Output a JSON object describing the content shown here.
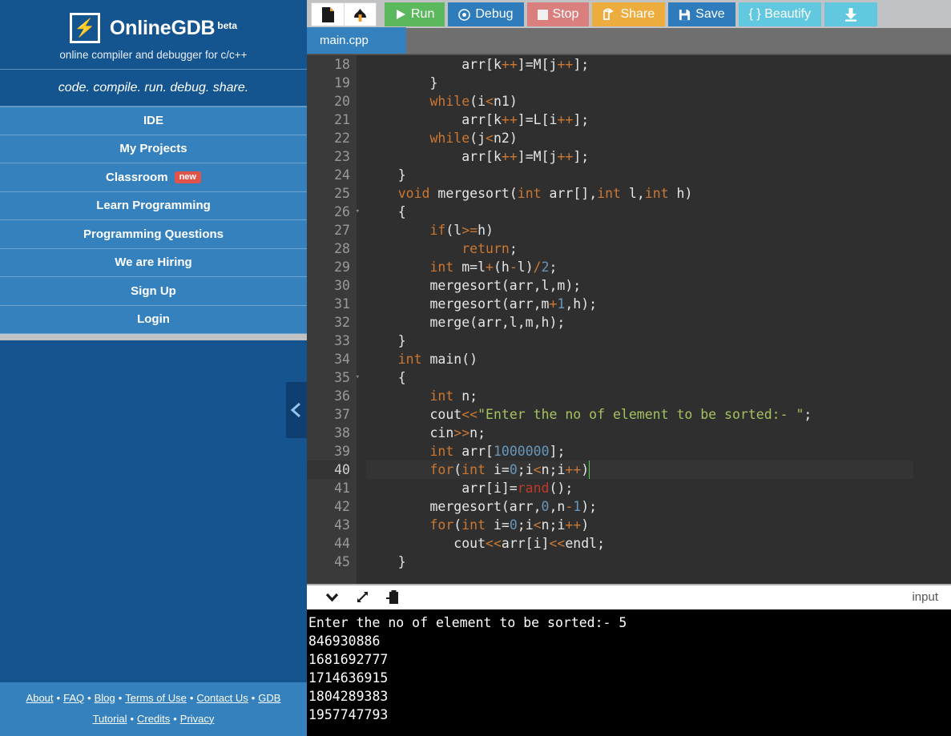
{
  "brand": {
    "logo_icon": "lightning-bolt-icon",
    "name": "OnlineGDB",
    "beta": "beta",
    "tagline": "online compiler and debugger for c/c++",
    "slogan": "code. compile. run. debug. share."
  },
  "sidebar": {
    "items": [
      {
        "label": "IDE",
        "badge": null
      },
      {
        "label": "My Projects",
        "badge": null
      },
      {
        "label": "Classroom",
        "badge": "new"
      },
      {
        "label": "Learn Programming",
        "badge": null
      },
      {
        "label": "Programming Questions",
        "badge": null
      },
      {
        "label": "We are Hiring",
        "badge": null
      },
      {
        "label": "Sign Up",
        "badge": null
      },
      {
        "label": "Login",
        "badge": null
      }
    ],
    "collapse_icon": "chevron-left-icon"
  },
  "footer": {
    "links": [
      "About",
      "FAQ",
      "Blog",
      "Terms of Use",
      "Contact Us",
      "GDB Tutorial",
      "Credits",
      "Privacy"
    ],
    "separator": "•"
  },
  "toolbar": {
    "new_file_icon": "new-file-icon",
    "upload_icon": "upload-icon",
    "run_label": "Run",
    "debug_label": "Debug",
    "stop_label": "Stop",
    "share_label": "Share",
    "save_label": "Save",
    "beautify_label": "{ } Beautify",
    "download_icon": "download-icon",
    "colors": {
      "run": "#5cb85c",
      "debug": "#2e7cbc",
      "stop": "#d9807f",
      "share": "#edad3e",
      "save": "#2e7cbc",
      "beautify": "#62c8e0"
    }
  },
  "tabs": [
    {
      "label": "main.cpp",
      "active": true
    }
  ],
  "editor": {
    "first_line": 18,
    "active_line": 40,
    "lines": [
      {
        "n": 18,
        "tokens": [
          {
            "t": "            arr[k",
            "c": "p"
          },
          {
            "t": "++",
            "c": "k"
          },
          {
            "t": "]=M[j",
            "c": "p"
          },
          {
            "t": "++",
            "c": "k"
          },
          {
            "t": "];",
            "c": "p"
          }
        ]
      },
      {
        "n": 19,
        "tokens": [
          {
            "t": "        }",
            "c": "p"
          }
        ]
      },
      {
        "n": 20,
        "tokens": [
          {
            "t": "        ",
            "c": "p"
          },
          {
            "t": "while",
            "c": "k"
          },
          {
            "t": "(i",
            "c": "p"
          },
          {
            "t": "<",
            "c": "k"
          },
          {
            "t": "n1)",
            "c": "p"
          }
        ]
      },
      {
        "n": 21,
        "tokens": [
          {
            "t": "            arr[k",
            "c": "p"
          },
          {
            "t": "++",
            "c": "k"
          },
          {
            "t": "]=L[i",
            "c": "p"
          },
          {
            "t": "++",
            "c": "k"
          },
          {
            "t": "];",
            "c": "p"
          }
        ]
      },
      {
        "n": 22,
        "tokens": [
          {
            "t": "        ",
            "c": "p"
          },
          {
            "t": "while",
            "c": "k"
          },
          {
            "t": "(j",
            "c": "p"
          },
          {
            "t": "<",
            "c": "k"
          },
          {
            "t": "n2)",
            "c": "p"
          }
        ]
      },
      {
        "n": 23,
        "tokens": [
          {
            "t": "            arr[k",
            "c": "p"
          },
          {
            "t": "++",
            "c": "k"
          },
          {
            "t": "]=M[j",
            "c": "p"
          },
          {
            "t": "++",
            "c": "k"
          },
          {
            "t": "];",
            "c": "p"
          }
        ]
      },
      {
        "n": 24,
        "tokens": [
          {
            "t": "    }",
            "c": "p"
          }
        ]
      },
      {
        "n": 25,
        "tokens": [
          {
            "t": "    ",
            "c": "p"
          },
          {
            "t": "void",
            "c": "k"
          },
          {
            "t": " mergesort(",
            "c": "p"
          },
          {
            "t": "int",
            "c": "k"
          },
          {
            "t": " arr[],",
            "c": "p"
          },
          {
            "t": "int",
            "c": "k"
          },
          {
            "t": " l,",
            "c": "p"
          },
          {
            "t": "int",
            "c": "k"
          },
          {
            "t": " h)",
            "c": "p"
          }
        ]
      },
      {
        "n": 26,
        "fold": true,
        "tokens": [
          {
            "t": "    {",
            "c": "p"
          }
        ]
      },
      {
        "n": 27,
        "tokens": [
          {
            "t": "        ",
            "c": "p"
          },
          {
            "t": "if",
            "c": "k"
          },
          {
            "t": "(l",
            "c": "p"
          },
          {
            "t": ">=",
            "c": "k"
          },
          {
            "t": "h)",
            "c": "p"
          }
        ]
      },
      {
        "n": 28,
        "tokens": [
          {
            "t": "            ",
            "c": "p"
          },
          {
            "t": "return",
            "c": "k"
          },
          {
            "t": ";",
            "c": "p"
          }
        ]
      },
      {
        "n": 29,
        "tokens": [
          {
            "t": "        ",
            "c": "p"
          },
          {
            "t": "int",
            "c": "k"
          },
          {
            "t": " m=l",
            "c": "p"
          },
          {
            "t": "+",
            "c": "k"
          },
          {
            "t": "(h",
            "c": "p"
          },
          {
            "t": "-",
            "c": "k"
          },
          {
            "t": "l)",
            "c": "p"
          },
          {
            "t": "/",
            "c": "k"
          },
          {
            "t": "2",
            "c": "n"
          },
          {
            "t": ";",
            "c": "p"
          }
        ]
      },
      {
        "n": 30,
        "tokens": [
          {
            "t": "        mergesort(arr,l,m);",
            "c": "p"
          }
        ]
      },
      {
        "n": 31,
        "tokens": [
          {
            "t": "        mergesort(arr,m",
            "c": "p"
          },
          {
            "t": "+",
            "c": "k"
          },
          {
            "t": "1",
            "c": "n"
          },
          {
            "t": ",h);",
            "c": "p"
          }
        ]
      },
      {
        "n": 32,
        "tokens": [
          {
            "t": "        merge(arr,l,m,h);",
            "c": "p"
          }
        ]
      },
      {
        "n": 33,
        "tokens": [
          {
            "t": "    }",
            "c": "p"
          }
        ]
      },
      {
        "n": 34,
        "tokens": [
          {
            "t": "    ",
            "c": "p"
          },
          {
            "t": "int",
            "c": "k"
          },
          {
            "t": " main()",
            "c": "p"
          }
        ]
      },
      {
        "n": 35,
        "fold": true,
        "tokens": [
          {
            "t": "    {",
            "c": "p"
          }
        ]
      },
      {
        "n": 36,
        "tokens": [
          {
            "t": "        ",
            "c": "p"
          },
          {
            "t": "int",
            "c": "k"
          },
          {
            "t": " n;",
            "c": "p"
          }
        ]
      },
      {
        "n": 37,
        "tokens": [
          {
            "t": "        cout",
            "c": "p"
          },
          {
            "t": "<<",
            "c": "k"
          },
          {
            "t": "\"Enter the no of element to be sorted:- \"",
            "c": "s"
          },
          {
            "t": ";",
            "c": "p"
          }
        ]
      },
      {
        "n": 38,
        "tokens": [
          {
            "t": "        cin",
            "c": "p"
          },
          {
            "t": ">>",
            "c": "k"
          },
          {
            "t": "n;",
            "c": "p"
          }
        ]
      },
      {
        "n": 39,
        "tokens": [
          {
            "t": "        ",
            "c": "p"
          },
          {
            "t": "int",
            "c": "k"
          },
          {
            "t": " arr[",
            "c": "p"
          },
          {
            "t": "1000000",
            "c": "n"
          },
          {
            "t": "];",
            "c": "p"
          }
        ]
      },
      {
        "n": 40,
        "active": true,
        "cursor": true,
        "tokens": [
          {
            "t": "        ",
            "c": "p"
          },
          {
            "t": "for",
            "c": "k"
          },
          {
            "t": "(",
            "c": "p"
          },
          {
            "t": "int",
            "c": "k"
          },
          {
            "t": " i=",
            "c": "p"
          },
          {
            "t": "0",
            "c": "n"
          },
          {
            "t": ";i",
            "c": "p"
          },
          {
            "t": "<",
            "c": "k"
          },
          {
            "t": "n;i",
            "c": "p"
          },
          {
            "t": "++",
            "c": "k"
          },
          {
            "t": ")",
            "c": "p"
          }
        ]
      },
      {
        "n": 41,
        "tokens": [
          {
            "t": "            arr[i]=",
            "c": "p"
          },
          {
            "t": "rand",
            "c": "f"
          },
          {
            "t": "();",
            "c": "p"
          }
        ]
      },
      {
        "n": 42,
        "tokens": [
          {
            "t": "        mergesort(arr,",
            "c": "p"
          },
          {
            "t": "0",
            "c": "n"
          },
          {
            "t": ",n",
            "c": "p"
          },
          {
            "t": "-",
            "c": "k"
          },
          {
            "t": "1",
            "c": "n"
          },
          {
            "t": ");",
            "c": "p"
          }
        ]
      },
      {
        "n": 43,
        "tokens": [
          {
            "t": "        ",
            "c": "p"
          },
          {
            "t": "for",
            "c": "k"
          },
          {
            "t": "(",
            "c": "p"
          },
          {
            "t": "int",
            "c": "k"
          },
          {
            "t": " i=",
            "c": "p"
          },
          {
            "t": "0",
            "c": "n"
          },
          {
            "t": ";i",
            "c": "p"
          },
          {
            "t": "<",
            "c": "k"
          },
          {
            "t": "n;i",
            "c": "p"
          },
          {
            "t": "++",
            "c": "k"
          },
          {
            "t": ")",
            "c": "p"
          }
        ]
      },
      {
        "n": 44,
        "tokens": [
          {
            "t": "           cout",
            "c": "p"
          },
          {
            "t": "<<",
            "c": "k"
          },
          {
            "t": "arr[i]",
            "c": "p"
          },
          {
            "t": "<<",
            "c": "k"
          },
          {
            "t": "endl;",
            "c": "p"
          }
        ]
      },
      {
        "n": 45,
        "tokens": [
          {
            "t": "    }",
            "c": "p"
          }
        ]
      }
    ]
  },
  "output": {
    "collapse_icon": "chevron-down-icon",
    "expand_icon": "expand-arrows-icon",
    "paste_icon": "paste-clipboard-icon",
    "input_label": "input",
    "console_lines": [
      "Enter the no of element to be sorted:- 5",
      "846930886",
      "1681692777",
      "1714636915",
      "1804289383",
      "1957747793"
    ]
  }
}
